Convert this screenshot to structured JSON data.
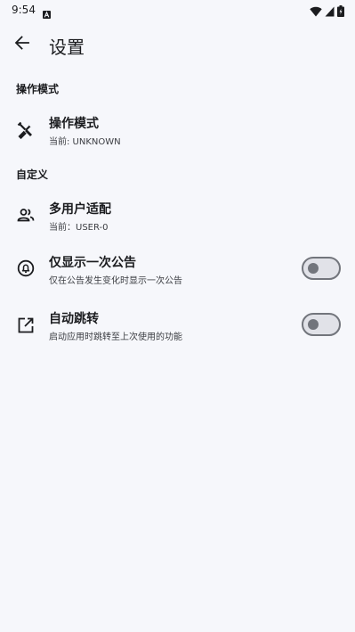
{
  "status_bar": {
    "time": "9:54"
  },
  "app_bar": {
    "title": "设置"
  },
  "sections": {
    "operation_mode": {
      "header": "操作模式",
      "item": {
        "title": "操作模式",
        "summary": "当前: UNKNOWN",
        "icon": "tools-icon"
      }
    },
    "custom": {
      "header": "自定义",
      "items": [
        {
          "title": "多用户适配",
          "summary": "当前：USER-0",
          "icon": "people-icon"
        },
        {
          "title": "仅显示一次公告",
          "summary": "仅在公告发生变化时显示一次公告",
          "icon": "notification-icon",
          "switch_on": false
        },
        {
          "title": "自动跳转",
          "summary": "启动应用时跳转至上次使用的功能",
          "icon": "open-in-new-icon",
          "switch_on": false
        }
      ]
    }
  },
  "colors": {
    "background": "#f6f7fb",
    "text": "#1b1c1f",
    "switch_track": "#e1e2e8",
    "switch_outline": "#72757c"
  }
}
